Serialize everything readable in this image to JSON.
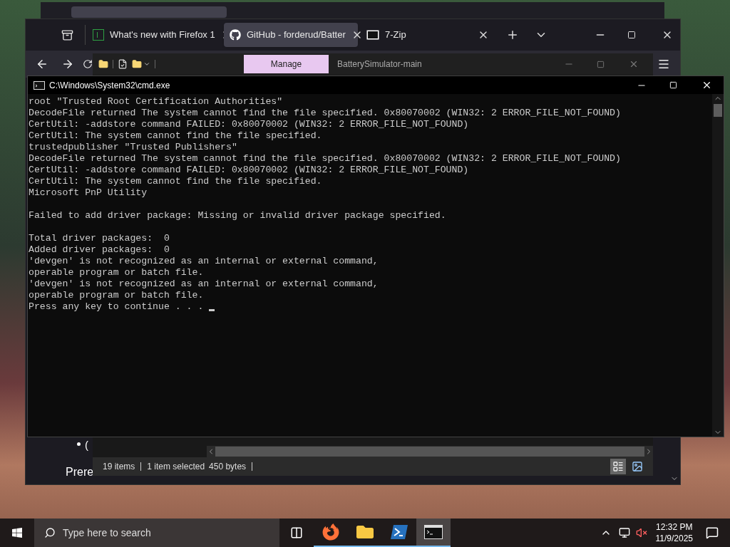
{
  "browser": {
    "tabs": [
      {
        "title": "What's new with Firefox 1",
        "kind": "firefox",
        "selected": false
      },
      {
        "title": "GitHub - forderud/Batter",
        "kind": "github",
        "selected": true
      },
      {
        "title": "7-Zip",
        "kind": "sevenzip",
        "selected": false
      }
    ],
    "page_text": {
      "bullet": "(",
      "heading": "Prere"
    }
  },
  "explorer": {
    "ribbon_tab": "Manage",
    "title": "BatterySimulator-main",
    "status": {
      "items": "19 items",
      "selection": "1 item selected",
      "size": "450 bytes"
    }
  },
  "console": {
    "title": "C:\\Windows\\System32\\cmd.exe",
    "blocks": [
      [
        "root \"Trusted Root Certification Authorities\"",
        "DecodeFile returned The system cannot find the file specified. 0x80070002 (WIN32: 2 ERROR_FILE_NOT_FOUND)",
        "CertUtil: -addstore command FAILED: 0x80070002 (WIN32: 2 ERROR_FILE_NOT_FOUND)",
        "CertUtil: The system cannot find the file specified.",
        "trustedpublisher \"Trusted Publishers\"",
        "DecodeFile returned The system cannot find the file specified. 0x80070002 (WIN32: 2 ERROR_FILE_NOT_FOUND)",
        "CertUtil: -addstore command FAILED: 0x80070002 (WIN32: 2 ERROR_FILE_NOT_FOUND)",
        "CertUtil: The system cannot find the file specified.",
        "Microsoft PnP Utility"
      ],
      [
        "Failed to add driver package: Missing or invalid driver package specified."
      ],
      [
        "Total driver packages:  0",
        "Added driver packages:  0",
        "'devgen' is not recognized as an internal or external command,",
        "operable program or batch file.",
        "'devgen' is not recognized as an internal or external command,",
        "operable program or batch file.",
        "Press any key to continue . . ."
      ]
    ]
  },
  "taskbar": {
    "search": {
      "placeholder": "Type here to search"
    },
    "apps": [
      {
        "kind": "firefox",
        "selected": false
      },
      {
        "kind": "explorer",
        "selected": false
      },
      {
        "kind": "powershell",
        "selected": false
      },
      {
        "kind": "cmd",
        "selected": true
      }
    ],
    "volume_muted": true,
    "time": "12:32 PM",
    "date": "11/9/2025"
  }
}
